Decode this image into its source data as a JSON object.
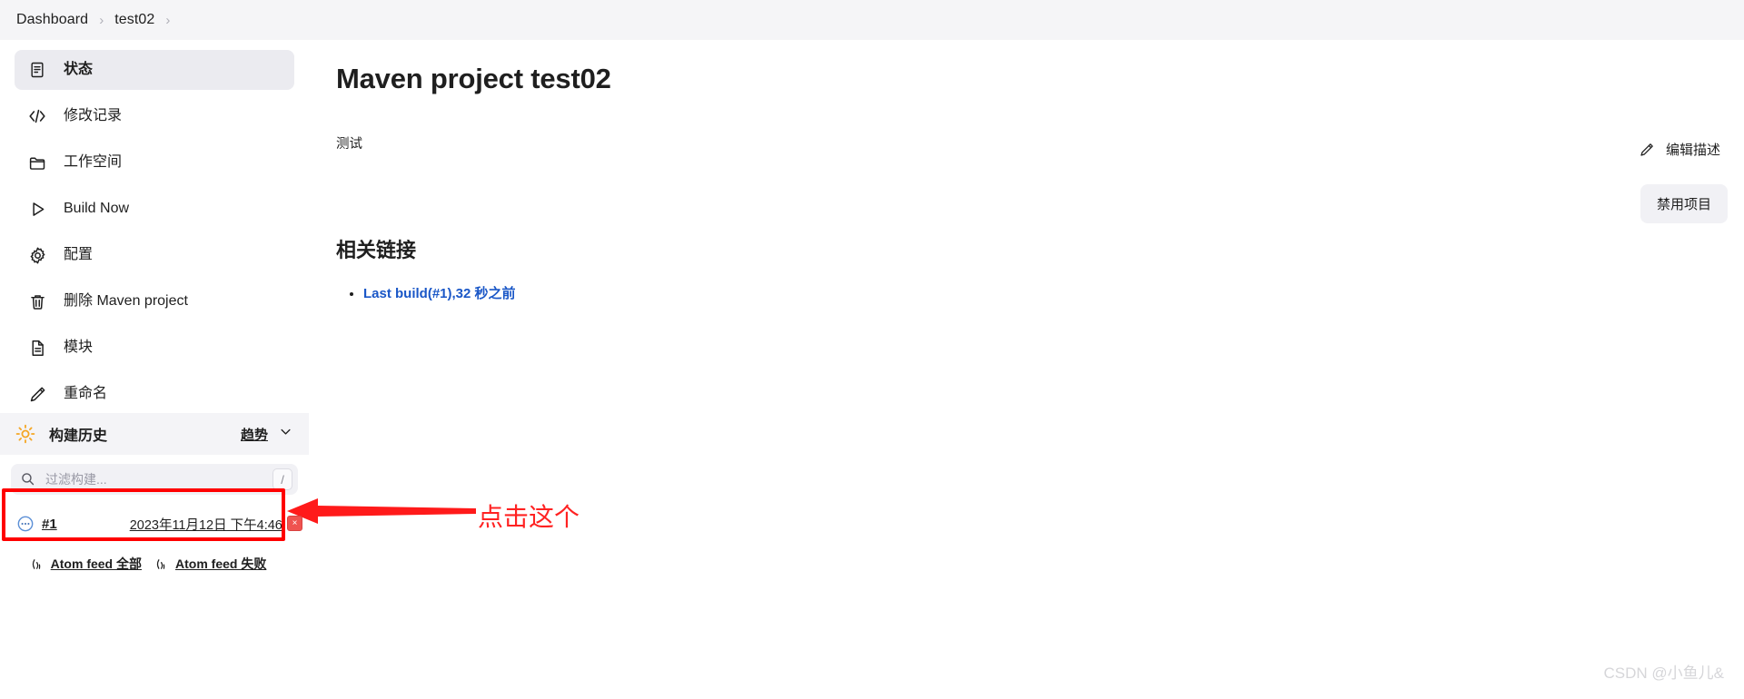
{
  "breadcrumb": {
    "items": [
      {
        "label": "Dashboard"
      },
      {
        "label": "test02"
      }
    ],
    "separator": "›"
  },
  "sidebar": {
    "items": [
      {
        "label": "状态",
        "icon": "status-document-icon",
        "active": true
      },
      {
        "label": "修改记录",
        "icon": "code-brackets-icon",
        "active": false
      },
      {
        "label": "工作空间",
        "icon": "folder-icon",
        "active": false
      },
      {
        "label": "Build Now",
        "icon": "play-triangle-icon",
        "active": false
      },
      {
        "label": "配置",
        "icon": "gear-icon",
        "active": false
      },
      {
        "label": "删除 Maven project",
        "icon": "trash-icon",
        "active": false
      },
      {
        "label": "模块",
        "icon": "file-lines-icon",
        "active": false
      },
      {
        "label": "重命名",
        "icon": "pencil-icon",
        "active": false
      }
    ]
  },
  "build_history": {
    "title": "构建历史",
    "trend_label": "趋势",
    "filter": {
      "placeholder": "过滤构建...",
      "value": "",
      "shortcut_hint": "/"
    },
    "builds": [
      {
        "number": "#1",
        "timestamp": "2023年11月12日 下午4:46",
        "status": "in-progress",
        "cancel_label": "×"
      }
    ],
    "feeds": [
      {
        "label": "Atom feed 全部"
      },
      {
        "label": "Atom feed 失败"
      }
    ]
  },
  "main": {
    "title": "Maven project test02",
    "description": "测试",
    "section_title": "相关链接",
    "links": [
      {
        "label": "Last build(#1),32 秒之前"
      }
    ]
  },
  "right_rail": {
    "edit_description_label": "编辑描述",
    "disable_project_label": "禁用项目"
  },
  "annotation": {
    "text": "点击这个",
    "color": "#ff2222"
  },
  "watermark": {
    "text": "CSDN @小鱼儿&"
  },
  "colors": {
    "accent_link": "#1a57c7",
    "panel_bg": "#f4f4f7",
    "active_item_bg": "#ebebf0",
    "annotation_red": "#ff0000",
    "progress_blue": "#1f5faa",
    "sun_yellow": "#f5a623"
  }
}
